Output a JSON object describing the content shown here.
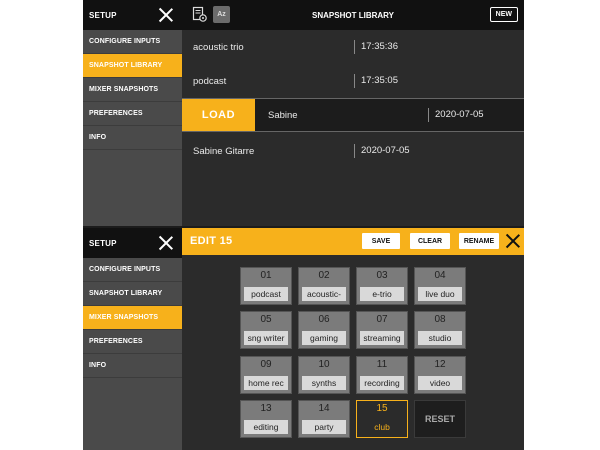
{
  "sidebar_top": {
    "title": "SETUP",
    "items": [
      {
        "label": "CONFIGURE INPUTS",
        "active": false
      },
      {
        "label": "SNAPSHOT LIBRARY",
        "active": true
      },
      {
        "label": "MIXER SNAPSHOTS",
        "active": false
      },
      {
        "label": "PREFERENCES",
        "active": false
      },
      {
        "label": "INFO",
        "active": false
      }
    ]
  },
  "sidebar_bottom": {
    "title": "SETUP",
    "items": [
      {
        "label": "CONFIGURE INPUTS",
        "active": false
      },
      {
        "label": "SNAPSHOT LIBRARY",
        "active": false
      },
      {
        "label": "MIXER SNAPSHOTS",
        "active": true
      },
      {
        "label": "PREFERENCES",
        "active": false
      },
      {
        "label": "INFO",
        "active": false
      }
    ]
  },
  "library": {
    "title": "SNAPSHOT LIBRARY",
    "sort_label": "Az",
    "new_label": "NEW",
    "load_label": "LOAD",
    "rows": [
      {
        "name": "acoustic trio",
        "time": "17:35:36"
      },
      {
        "name": "podcast",
        "time": "17:35:05"
      },
      {
        "name": "Sabine",
        "time": "2020-07-05"
      },
      {
        "name": "Sabine Gitarre",
        "time": "2020-07-05"
      }
    ]
  },
  "edit": {
    "title": "EDIT 15",
    "save_label": "SAVE",
    "clear_label": "CLEAR",
    "rename_label": "RENAME",
    "reset_label": "RESET",
    "slots": [
      {
        "num": "01",
        "label": "podcast"
      },
      {
        "num": "02",
        "label": "acoustic-"
      },
      {
        "num": "03",
        "label": "e-trio"
      },
      {
        "num": "04",
        "label": "live duo"
      },
      {
        "num": "05",
        "label": "sng writer"
      },
      {
        "num": "06",
        "label": "gaming"
      },
      {
        "num": "07",
        "label": "streaming"
      },
      {
        "num": "08",
        "label": "studio"
      },
      {
        "num": "09",
        "label": "home rec"
      },
      {
        "num": "10",
        "label": "synths"
      },
      {
        "num": "11",
        "label": "recording"
      },
      {
        "num": "12",
        "label": "video"
      },
      {
        "num": "13",
        "label": "editing"
      },
      {
        "num": "14",
        "label": "party"
      },
      {
        "num": "15",
        "label": "club"
      }
    ]
  },
  "colors": {
    "accent": "#f7b11b",
    "panel": "#2b2b2b",
    "sidebar": "#4a4a4a"
  }
}
